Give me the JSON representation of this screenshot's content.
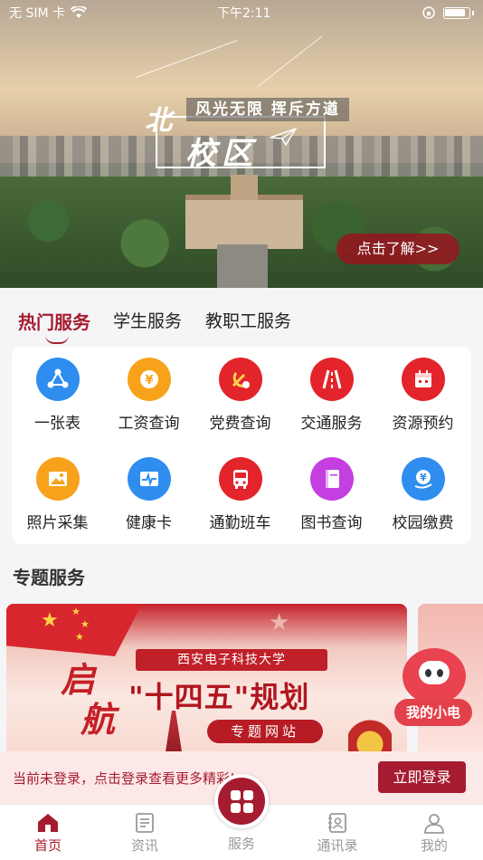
{
  "status_bar": {
    "carrier": "无 SIM 卡",
    "time": "下午2:11"
  },
  "banner": {
    "title_char": "北",
    "title_main": "校区",
    "slogan": "风光无限 挥斥方遒",
    "cta": "点击了解>>"
  },
  "service_tabs": [
    {
      "label": "热门服务",
      "active": true
    },
    {
      "label": "学生服务",
      "active": false
    },
    {
      "label": "教职工服务",
      "active": false
    }
  ],
  "services": [
    {
      "label": "一张表",
      "icon": "share-icon",
      "color": "#2f8df0"
    },
    {
      "label": "工资查询",
      "icon": "yen-coin-icon",
      "color": "#f7a21a"
    },
    {
      "label": "党费查询",
      "icon": "party-emblem-icon",
      "color": "#e3242b"
    },
    {
      "label": "交通服务",
      "icon": "road-icon",
      "color": "#e3242b"
    },
    {
      "label": "资源预约",
      "icon": "calendar-icon",
      "color": "#e3242b"
    },
    {
      "label": "照片采集",
      "icon": "photo-icon",
      "color": "#f7a21a"
    },
    {
      "label": "健康卡",
      "icon": "heartbeat-icon",
      "color": "#2f8df0"
    },
    {
      "label": "通勤班车",
      "icon": "bus-icon",
      "color": "#e3242b"
    },
    {
      "label": "图书查询",
      "icon": "book-icon",
      "color": "#c33fe0"
    },
    {
      "label": "校园缴费",
      "icon": "payment-icon",
      "color": "#2f8df0"
    }
  ],
  "topic_section": {
    "title": "专题服务",
    "card": {
      "university": "西安电子科技大学",
      "headline": "\"十四五\"规划",
      "side_text_1": "启",
      "side_text_2": "航",
      "button": "专题网站"
    }
  },
  "assistant": {
    "label": "我的小电"
  },
  "login_bar": {
    "message": "当前未登录，点击登录查看更多精彩!",
    "button": "立即登录"
  },
  "bottom_nav": [
    {
      "label": "首页",
      "icon": "home-icon",
      "active": true
    },
    {
      "label": "资讯",
      "icon": "news-icon",
      "active": false
    },
    {
      "label": "服务",
      "icon": "grid-icon",
      "active": false
    },
    {
      "label": "通讯录",
      "icon": "contacts-icon",
      "active": false
    },
    {
      "label": "我的",
      "icon": "profile-icon",
      "active": false
    }
  ],
  "colors": {
    "brand": "#a51c30",
    "tab_bg": "#f5f5f7"
  }
}
